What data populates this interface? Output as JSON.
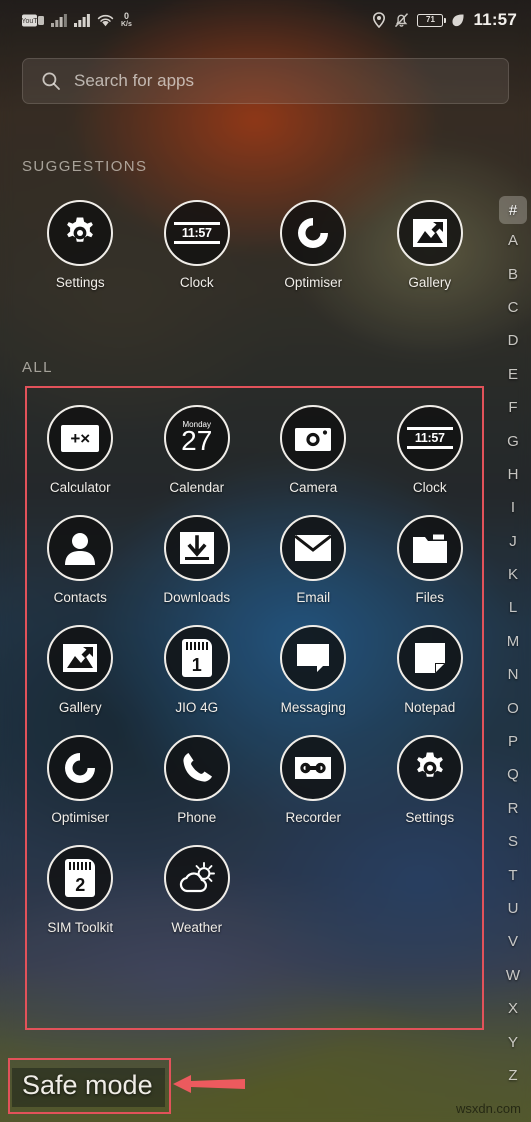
{
  "statusbar": {
    "icons_left": [
      "youtube-badge-icon",
      "signal-bars-icon",
      "signal-bars-2-icon",
      "wifi-icon"
    ],
    "data_rate_value": "0",
    "data_rate_unit": "K/s",
    "icons_right": [
      "location-icon",
      "notifications-muted-icon",
      "battery-icon",
      "power-saving-leaf-icon"
    ],
    "battery_level": "71",
    "time": "11:57"
  },
  "search": {
    "placeholder": "Search for apps",
    "icon": "search-icon"
  },
  "sections": {
    "suggestions_title": "SUGGESTIONS",
    "all_title": "ALL"
  },
  "suggestions": [
    {
      "label": "Settings",
      "icon": "gear-icon"
    },
    {
      "label": "Clock",
      "icon": "clock-icon",
      "time": "11:57"
    },
    {
      "label": "Optimiser",
      "icon": "optimiser-icon"
    },
    {
      "label": "Gallery",
      "icon": "gallery-icon"
    }
  ],
  "all_apps": [
    {
      "label": "Calculator",
      "icon": "calculator-icon",
      "glyphs": "+×"
    },
    {
      "label": "Calendar",
      "icon": "calendar-icon",
      "weekday": "Monday",
      "day": "27"
    },
    {
      "label": "Camera",
      "icon": "camera-icon"
    },
    {
      "label": "Clock",
      "icon": "clock-icon",
      "time": "11:57"
    },
    {
      "label": "Contacts",
      "icon": "contacts-person-icon"
    },
    {
      "label": "Downloads",
      "icon": "download-arrow-icon"
    },
    {
      "label": "Email",
      "icon": "envelope-icon"
    },
    {
      "label": "Files",
      "icon": "folder-icon"
    },
    {
      "label": "Gallery",
      "icon": "gallery-icon"
    },
    {
      "label": "JIO 4G",
      "icon": "sim-card-icon",
      "sim_number": "1"
    },
    {
      "label": "Messaging",
      "icon": "message-bubble-icon"
    },
    {
      "label": "Notepad",
      "icon": "notepad-icon"
    },
    {
      "label": "Optimiser",
      "icon": "optimiser-icon"
    },
    {
      "label": "Phone",
      "icon": "phone-handset-icon"
    },
    {
      "label": "Recorder",
      "icon": "recorder-tape-icon"
    },
    {
      "label": "Settings",
      "icon": "gear-icon"
    },
    {
      "label": "SIM Toolkit",
      "icon": "sim-card-icon",
      "sim_number": "2"
    },
    {
      "label": "Weather",
      "icon": "weather-sun-cloud-icon"
    }
  ],
  "alphabet_index": {
    "selected": "#",
    "letters": [
      "#",
      "A",
      "B",
      "C",
      "D",
      "E",
      "F",
      "G",
      "H",
      "I",
      "J",
      "K",
      "L",
      "M",
      "N",
      "O",
      "P",
      "Q",
      "R",
      "S",
      "T",
      "U",
      "V",
      "W",
      "X",
      "Y",
      "Z"
    ]
  },
  "safe_mode": {
    "label": "Safe mode"
  },
  "annotations": {
    "color": "#e2525a",
    "arrow": "left-pointing-arrow"
  },
  "watermark": "wsxdn.com"
}
